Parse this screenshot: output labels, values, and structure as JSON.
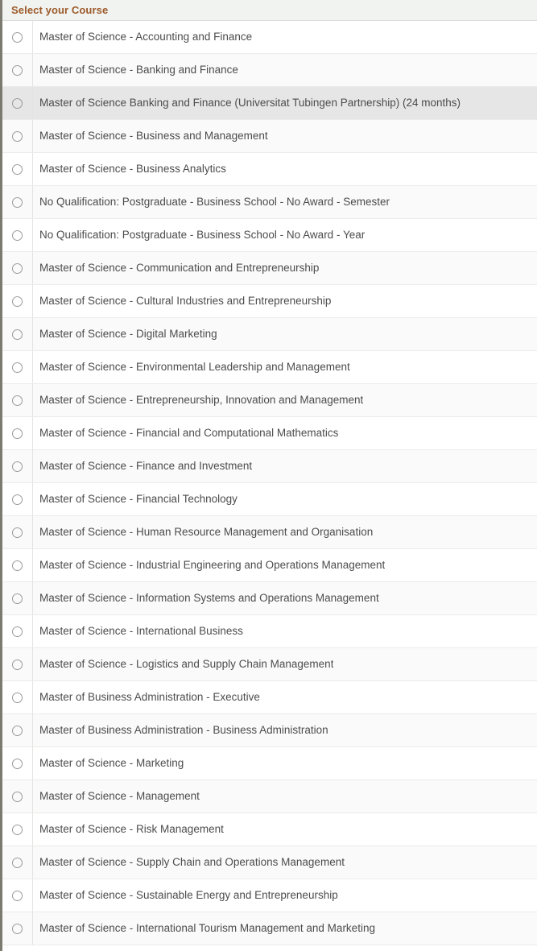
{
  "header": {
    "title": "Select your Course",
    "title_color": "#9c5a29",
    "background_color": "#f1f3f1"
  },
  "colors": {
    "row_default": "#ffffff",
    "row_alternate": "#fafafa",
    "row_highlight": "#e6e6e6",
    "row_divider": "#ebebe9",
    "panel_left_border": "#7d7a70",
    "label_text": "#4c4c4c",
    "radio_outline": "#9a9a9a"
  },
  "list": {
    "name": "course-selection-list",
    "input_type": "radio",
    "selected_index": null,
    "highlighted_index": 2,
    "rows": [
      {
        "label": "Master of Science - Accounting and Finance",
        "selected": false
      },
      {
        "label": "Master of Science - Banking and Finance",
        "selected": false
      },
      {
        "label": "Master of Science Banking and Finance (Universitat Tubingen Partnership) (24 months)",
        "selected": false
      },
      {
        "label": "Master of Science - Business and Management",
        "selected": false
      },
      {
        "label": "Master of Science - Business Analytics",
        "selected": false
      },
      {
        "label": "No Qualification: Postgraduate - Business School - No Award - Semester",
        "selected": false
      },
      {
        "label": "No Qualification: Postgraduate - Business School - No Award - Year",
        "selected": false
      },
      {
        "label": "Master of Science - Communication and Entrepreneurship",
        "selected": false
      },
      {
        "label": "Master of Science - Cultural Industries and Entrepreneurship",
        "selected": false
      },
      {
        "label": "Master of Science - Digital Marketing",
        "selected": false
      },
      {
        "label": "Master of Science - Environmental Leadership and Management",
        "selected": false
      },
      {
        "label": "Master of Science - Entrepreneurship, Innovation and Management",
        "selected": false
      },
      {
        "label": "Master of Science - Financial and Computational Mathematics",
        "selected": false
      },
      {
        "label": "Master of Science - Finance and Investment",
        "selected": false
      },
      {
        "label": "Master of Science - Financial Technology",
        "selected": false
      },
      {
        "label": "Master of Science - Human Resource Management and Organisation",
        "selected": false
      },
      {
        "label": "Master of Science - Industrial Engineering and Operations Management",
        "selected": false
      },
      {
        "label": "Master of Science - Information Systems and Operations Management",
        "selected": false
      },
      {
        "label": "Master of Science - International Business",
        "selected": false
      },
      {
        "label": "Master of Science - Logistics and Supply Chain Management",
        "selected": false
      },
      {
        "label": "Master of Business Administration - Executive",
        "selected": false
      },
      {
        "label": "Master of Business Administration - Business Administration",
        "selected": false
      },
      {
        "label": "Master of Science - Marketing",
        "selected": false
      },
      {
        "label": "Master of Science - Management",
        "selected": false
      },
      {
        "label": "Master of Science - Risk Management",
        "selected": false
      },
      {
        "label": "Master of Science - Supply Chain and Operations Management",
        "selected": false
      },
      {
        "label": "Master of Science - Sustainable Energy and Entrepreneurship",
        "selected": false
      },
      {
        "label": "Master of Science - International Tourism Management and Marketing",
        "selected": false
      }
    ]
  }
}
